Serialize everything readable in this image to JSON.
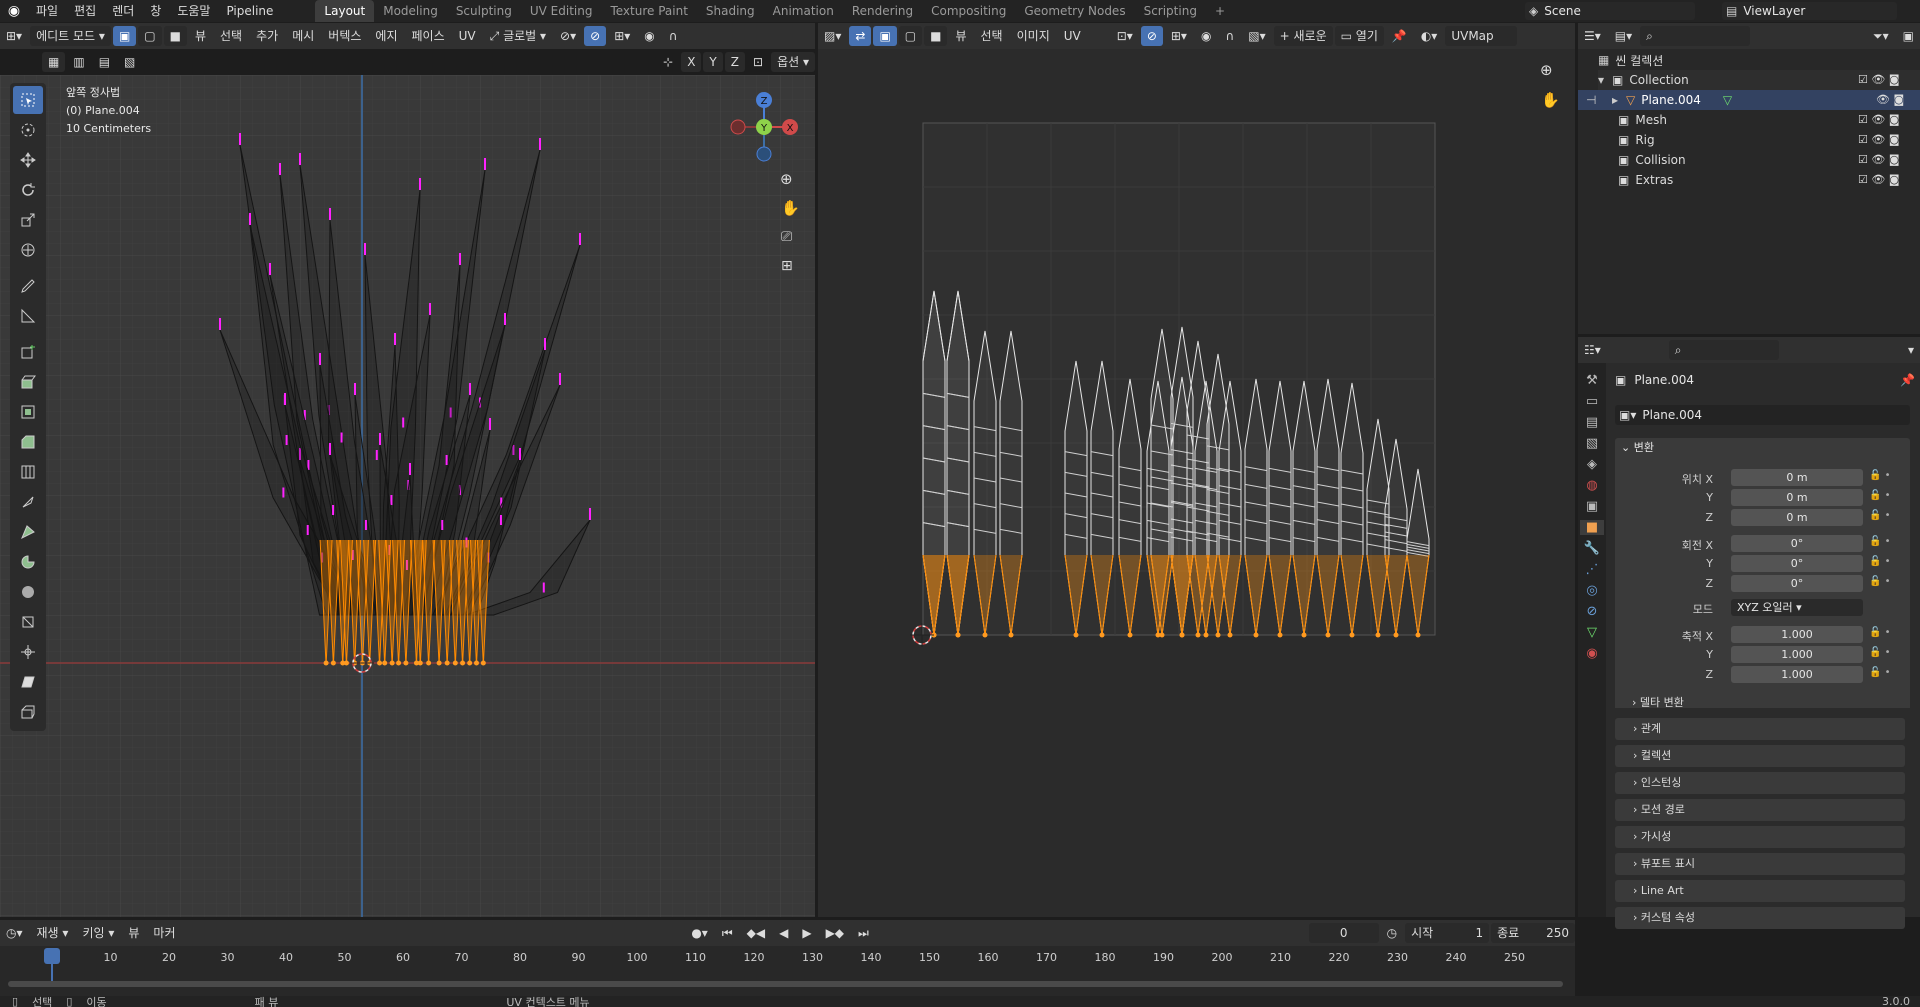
{
  "topbar": {
    "menus": [
      "파일",
      "편집",
      "렌더",
      "창",
      "도움말",
      "Pipeline"
    ],
    "workspaces": [
      "Layout",
      "Modeling",
      "Sculpting",
      "UV Editing",
      "Texture Paint",
      "Shading",
      "Animation",
      "Rendering",
      "Compositing",
      "Geometry Nodes",
      "Scripting"
    ],
    "active_workspace": "Layout",
    "add_tab": "+",
    "scene": "Scene",
    "view_layer": "ViewLayer"
  },
  "viewport": {
    "mode": "에디트 모드",
    "menus": [
      "뷰",
      "선택",
      "추가",
      "메시",
      "버텍스",
      "에지",
      "페이스",
      "UV"
    ],
    "transform_orientation": "글로벌",
    "axes": [
      "X",
      "Y",
      "Z"
    ],
    "options_label": "옵션",
    "info": [
      "앞쪽 정사법",
      "(0) Plane.004",
      "10 Centimeters"
    ],
    "gizmo": {
      "z": "Z",
      "y": "Y",
      "x": "X"
    }
  },
  "uv_editor": {
    "menus": [
      "뷰",
      "선택",
      "이미지",
      "UV"
    ],
    "new_button": "새로운",
    "open_button": "열기",
    "uv_map": "UVMap"
  },
  "outliner": {
    "items": [
      {
        "label": "씬 컬렉션",
        "indent": 0
      },
      {
        "label": "Collection",
        "indent": 1
      },
      {
        "label": "Plane.004",
        "indent": 2
      },
      {
        "label": "Mesh",
        "indent": 1
      },
      {
        "label": "Rig",
        "indent": 1
      },
      {
        "label": "Collision",
        "indent": 1
      },
      {
        "label": "Extras",
        "indent": 1
      }
    ]
  },
  "properties": {
    "object_name": "Plane.004",
    "object_field": "Plane.004",
    "transform_header": "변환",
    "location_label": "위치 X",
    "rotation_label": "회전 X",
    "scale_label": "축적 X",
    "y_label": "Y",
    "z_label": "Z",
    "loc": [
      "0 m",
      "0 m",
      "0 m"
    ],
    "rot": [
      "0°",
      "0°",
      "0°"
    ],
    "mode_label": "모드",
    "mode_value": "XYZ 오일러",
    "scale": [
      "1.000",
      "1.000",
      "1.000"
    ],
    "delta_label": "델타 변환",
    "panels": [
      "관계",
      "컬렉션",
      "인스턴싱",
      "모션 경로",
      "가시성",
      "뷰포트 표시",
      "Line Art",
      "커스텀 속성"
    ]
  },
  "timeline": {
    "menus": [
      "재생",
      "키잉",
      "뷰",
      "마커"
    ],
    "current_frame": "0",
    "start_label": "시작",
    "start": "1",
    "end_label": "종료",
    "end": "250",
    "ticks": [
      "0",
      "10",
      "20",
      "30",
      "40",
      "50",
      "60",
      "70",
      "80",
      "90",
      "100",
      "110",
      "120",
      "130",
      "140",
      "150",
      "160",
      "170",
      "180",
      "190",
      "200",
      "210",
      "220",
      "230",
      "240",
      "250"
    ]
  },
  "statusbar": {
    "items": [
      "선택",
      "이동",
      "패 뷰",
      "UV 컨텍스트 메뉴"
    ],
    "version": "3.0.0"
  },
  "colors": {
    "accent": "#4772b3",
    "selected_vertex": "#ff8a00",
    "pin": "#ff22ff",
    "bg_viewport": "#393939"
  }
}
